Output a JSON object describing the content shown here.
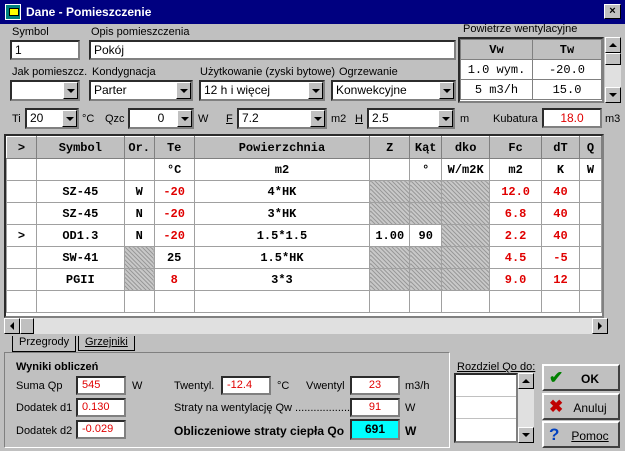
{
  "window": {
    "title": "Dane - Pomieszczenie",
    "close": "×"
  },
  "form": {
    "symbol_label": "Symbol",
    "symbol_value": "1",
    "opis_label": "Opis pomieszczenia",
    "opis_value": "Pokój",
    "jak_label": "Jak pomieszcz.",
    "jak_value": "",
    "kond_label": "Kondygnacja",
    "kond_value": "Parter",
    "uzyt_label": "Użytkowanie (zyski bytowe)",
    "uzyt_value": "12 h i więcej",
    "ogrz_label": "Ogrzewanie",
    "ogrz_value": "Konwekcyjne",
    "ti_label": "Ti",
    "ti_value": "20",
    "ti_unit": "°C",
    "qzc_label": "Qzc",
    "qzc_value": "0",
    "qzc_unit": "W",
    "f_label": "F",
    "f_value": "7.2",
    "f_unit": "m2",
    "h_label": "H",
    "h_value": "2.5",
    "h_unit": "m",
    "kub_label": "Kubatura",
    "kub_value": "18.0",
    "kub_unit": "m3"
  },
  "vent": {
    "title": "Powietrze wentylacyjne",
    "col_vw": "Vw",
    "col_tw": "Tw",
    "rows": [
      {
        "vw": "1.0 wym.",
        "tw": "-20.0"
      },
      {
        "vw": "5 m3/h",
        "tw": "15.0"
      }
    ]
  },
  "grid": {
    "headers": [
      ">",
      "Symbol",
      "Or.",
      "Te",
      "Powierzchnia",
      "Z",
      "Kąt",
      "dko",
      "Fc",
      "dT",
      "Q"
    ],
    "units": [
      "",
      "",
      "",
      "°C",
      "m2",
      "",
      "°",
      "W/m2K",
      "m2",
      "K",
      "W"
    ],
    "rows": [
      {
        "mark": "",
        "symbol": "SZ-45",
        "or": "W",
        "te": "-20",
        "pow": "4*HK",
        "z": "",
        "kat": "",
        "dko": "",
        "fc": "12.0",
        "dt": "40"
      },
      {
        "mark": "",
        "symbol": "SZ-45",
        "or": "N",
        "te": "-20",
        "pow": "3*HK",
        "z": "",
        "kat": "",
        "dko": "",
        "fc": "6.8",
        "dt": "40"
      },
      {
        "mark": ">",
        "symbol": "OD1.3",
        "or": "N",
        "te": "-20",
        "pow": "1.5*1.5",
        "z": "1.00",
        "kat": "90",
        "dko": "",
        "fc": "2.2",
        "dt": "40"
      },
      {
        "mark": "",
        "symbol": "SW-41",
        "or": "",
        "te": "25",
        "pow": "1.5*HK",
        "z": "",
        "kat": "",
        "dko": "",
        "fc": "4.5",
        "dt": "-5"
      },
      {
        "mark": "",
        "symbol": "PGII",
        "or": "",
        "te": "8",
        "pow": "3*3",
        "z": "",
        "kat": "",
        "dko": "",
        "fc": "9.0",
        "dt": "12"
      },
      {
        "mark": "",
        "symbol": "",
        "or": "",
        "te": "",
        "pow": "",
        "z": "",
        "kat": "",
        "dko": "",
        "fc": "",
        "dt": ""
      }
    ]
  },
  "tabs": [
    "Przegrody",
    "Grzejniki"
  ],
  "results": {
    "title": "Wyniki obliczeń",
    "suma_label": "Suma Qp",
    "suma_value": "545",
    "suma_unit": "W",
    "d1_label": "Dodatek d1",
    "d1_value": "0.130",
    "d2_label": "Dodatek d2",
    "d2_value": "-0.029",
    "twent_label": "Twentyl.",
    "twent_value": "-12.4",
    "twent_unit": "°C",
    "vwent_label": "Vwentyl",
    "vwent_value": "23",
    "vwent_unit": "m3/h",
    "straty_label": "Straty na wentylację Qw ..................",
    "straty_value": "91",
    "straty_unit": "W",
    "obl_label": "Obliczeniowe straty ciepła Qo",
    "obl_value": "691",
    "obl_unit": "W"
  },
  "rozdziel": {
    "label": "Rozdziel Qo do:"
  },
  "buttons": {
    "ok": "OK",
    "anuluj": "Anuluj",
    "pomoc": "Pomoc"
  },
  "colors": {
    "title_bg": "#000080",
    "accent_red": "#e00000",
    "highlight": "#00ffff"
  }
}
